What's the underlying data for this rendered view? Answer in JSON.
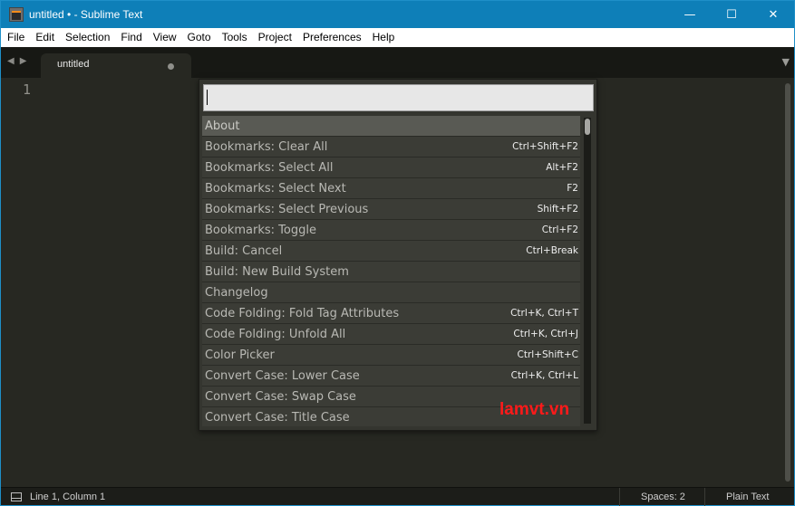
{
  "window": {
    "title": "untitled • - Sublime Text",
    "controls": {
      "minimize": "—",
      "maximize": "☐",
      "close": "✕"
    }
  },
  "menu": [
    "File",
    "Edit",
    "Selection",
    "Find",
    "View",
    "Goto",
    "Tools",
    "Project",
    "Preferences",
    "Help"
  ],
  "tabs": {
    "nav_back": "◀",
    "nav_forward": "▶",
    "active_label": "untitled",
    "dropdown": "▼"
  },
  "editor": {
    "line_number": "1"
  },
  "palette": {
    "query": "",
    "items": [
      {
        "label": "About",
        "shortcut": "",
        "selected": true
      },
      {
        "label": "Bookmarks: Clear All",
        "shortcut": "Ctrl+Shift+F2"
      },
      {
        "label": "Bookmarks: Select All",
        "shortcut": "Alt+F2"
      },
      {
        "label": "Bookmarks: Select Next",
        "shortcut": "F2"
      },
      {
        "label": "Bookmarks: Select Previous",
        "shortcut": "Shift+F2"
      },
      {
        "label": "Bookmarks: Toggle",
        "shortcut": "Ctrl+F2"
      },
      {
        "label": "Build: Cancel",
        "shortcut": "Ctrl+Break"
      },
      {
        "label": "Build: New Build System",
        "shortcut": ""
      },
      {
        "label": "Changelog",
        "shortcut": ""
      },
      {
        "label": "Code Folding: Fold Tag Attributes",
        "shortcut": "Ctrl+K, Ctrl+T"
      },
      {
        "label": "Code Folding: Unfold All",
        "shortcut": "Ctrl+K, Ctrl+J"
      },
      {
        "label": "Color Picker",
        "shortcut": "Ctrl+Shift+C"
      },
      {
        "label": "Convert Case: Lower Case",
        "shortcut": "Ctrl+K, Ctrl+L"
      },
      {
        "label": "Convert Case: Swap Case",
        "shortcut": ""
      },
      {
        "label": "Convert Case: Title Case",
        "shortcut": ""
      }
    ]
  },
  "watermark": "lamvt.vn",
  "status": {
    "position": "Line 1, Column 1",
    "spaces": "Spaces: 2",
    "syntax": "Plain Text"
  },
  "colors": {
    "titlebar": "#0e7fb8",
    "editor_bg": "#272822",
    "palette_bg": "#34352f",
    "watermark": "#ff1a1a"
  }
}
